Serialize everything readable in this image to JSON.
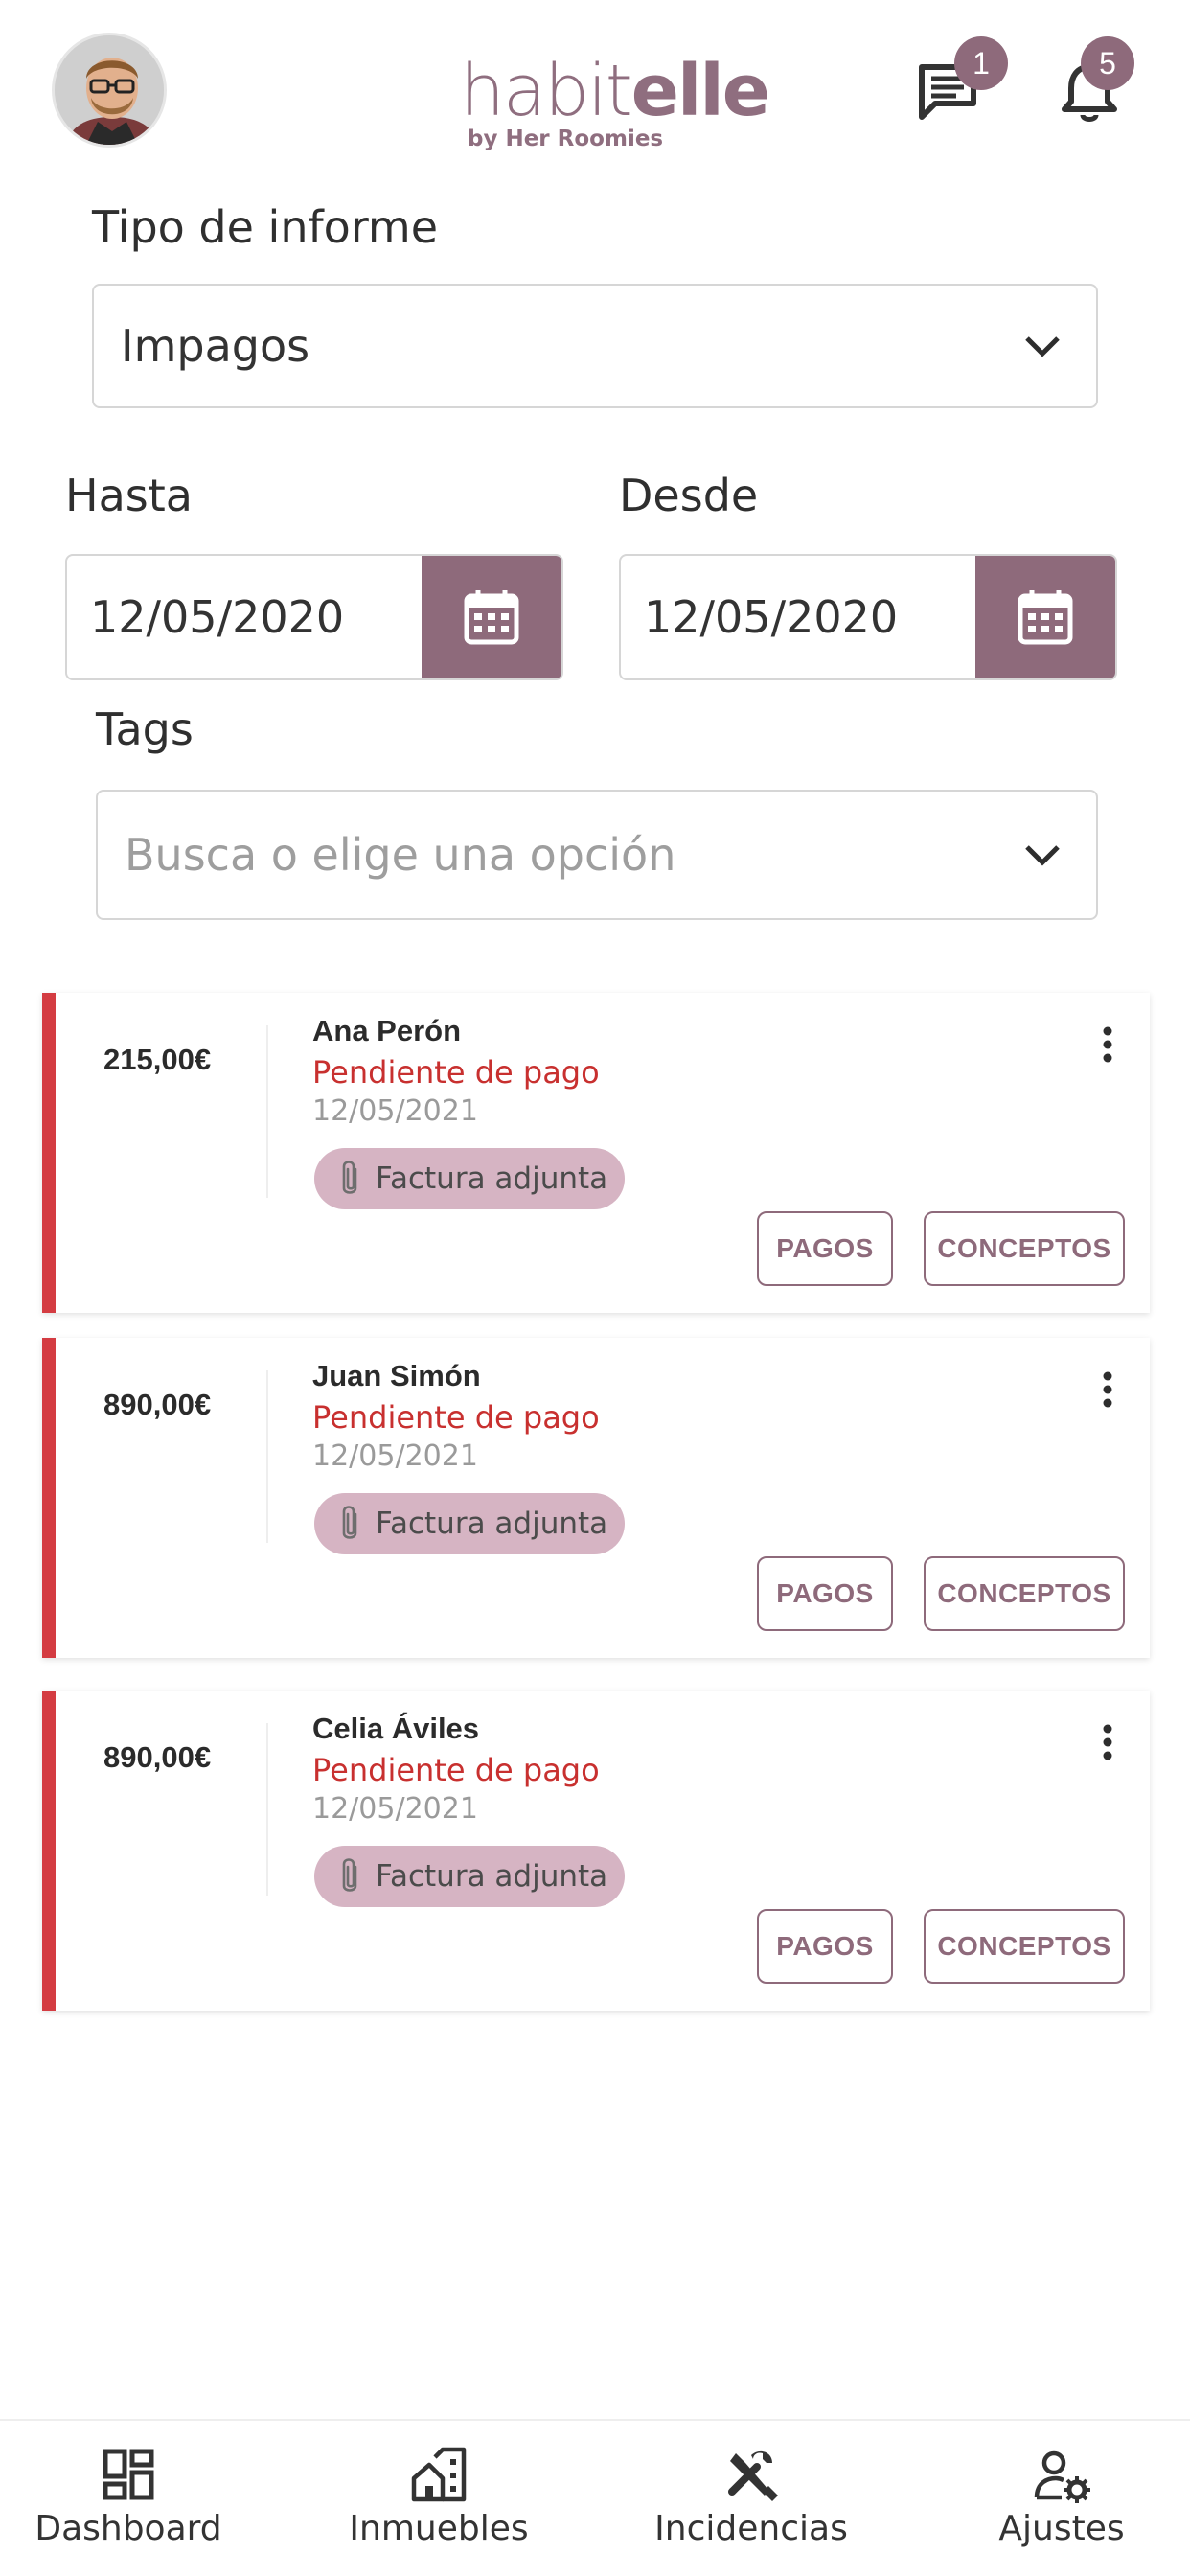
{
  "header": {
    "logo_main_light": "habit",
    "logo_main_bold": "elle",
    "logo_sub": "by Her Roomies",
    "messages_badge": "1",
    "notifications_badge": "5"
  },
  "form": {
    "report_type_label": "Tipo de informe",
    "report_type_value": "Impagos",
    "to_label": "Hasta",
    "to_value": "12/05/2020",
    "from_label": "Desde",
    "from_value": "12/05/2020",
    "tags_label": "Tags",
    "tags_placeholder": "Busca o elige una opción"
  },
  "cards": [
    {
      "amount": "215,00€",
      "name": "Ana Perón",
      "status": "Pendiente de pago",
      "date": "12/05/2021",
      "chip": "Factura adjunta",
      "btn_pagos": "PAGOS",
      "btn_conceptos": "CONCEPTOS"
    },
    {
      "amount": "890,00€",
      "name": "Juan Simón",
      "status": "Pendiente de pago",
      "date": "12/05/2021",
      "chip": "Factura adjunta",
      "btn_pagos": "PAGOS",
      "btn_conceptos": "CONCEPTOS"
    },
    {
      "amount": "890,00€",
      "name": "Celia Áviles",
      "status": "Pendiente de pago",
      "date": "12/05/2021",
      "chip": "Factura adjunta",
      "btn_pagos": "PAGOS",
      "btn_conceptos": "CONCEPTOS"
    }
  ],
  "nav": [
    {
      "label": "Dashboard",
      "icon": "dashboard-icon"
    },
    {
      "label": "Inmuebles",
      "icon": "buildings-icon"
    },
    {
      "label": "Incidencias",
      "icon": "tools-icon"
    },
    {
      "label": "Ajustes",
      "icon": "user-settings-icon"
    }
  ],
  "colors": {
    "brand": "#8e6a7b",
    "alert": "#d43c42",
    "status_text": "#c8302f",
    "chip_bg": "#d6b4c3"
  }
}
